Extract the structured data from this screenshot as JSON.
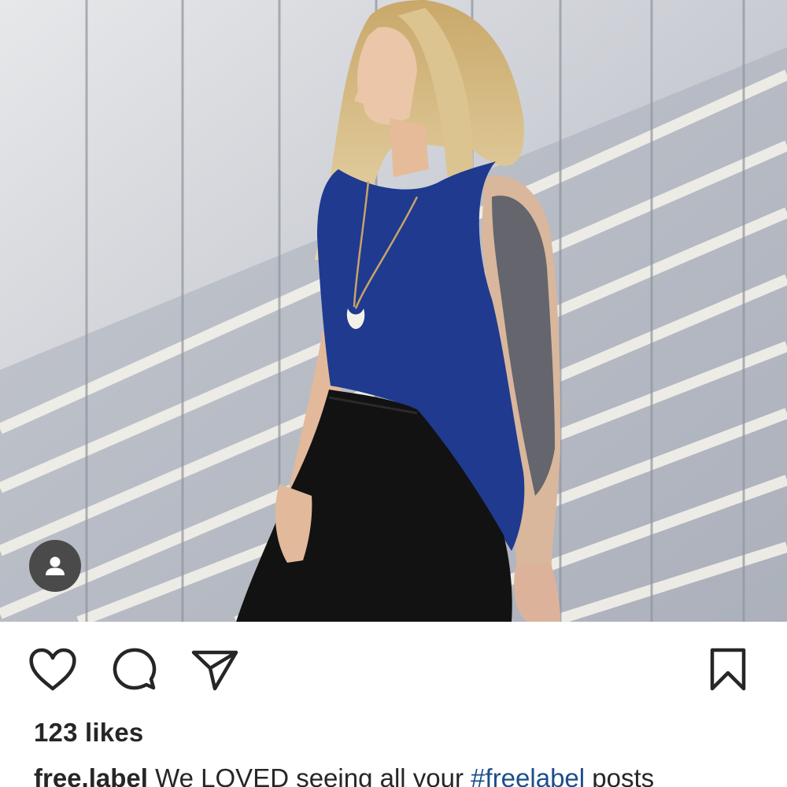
{
  "post": {
    "photo_alt": "Woman in a navy sleeveless top and black jeans leaning against a grey wooden wall with striped sunlight"
  },
  "actions": {
    "like_icon": "heart-icon",
    "comment_icon": "comment-bubble-icon",
    "share_icon": "paper-plane-icon",
    "save_icon": "bookmark-icon",
    "tag_icon": "user-tag-icon"
  },
  "stats": {
    "likes_text": "123 likes"
  },
  "caption": {
    "username": "free.label",
    "text_before": " We LOVED seeing all your ",
    "hashtag": "#freelabel",
    "text_after": " posts"
  },
  "colors": {
    "text": "#262626",
    "hashtag": "#1b4f8a",
    "tag_button_bg": "#4a4a4a"
  }
}
